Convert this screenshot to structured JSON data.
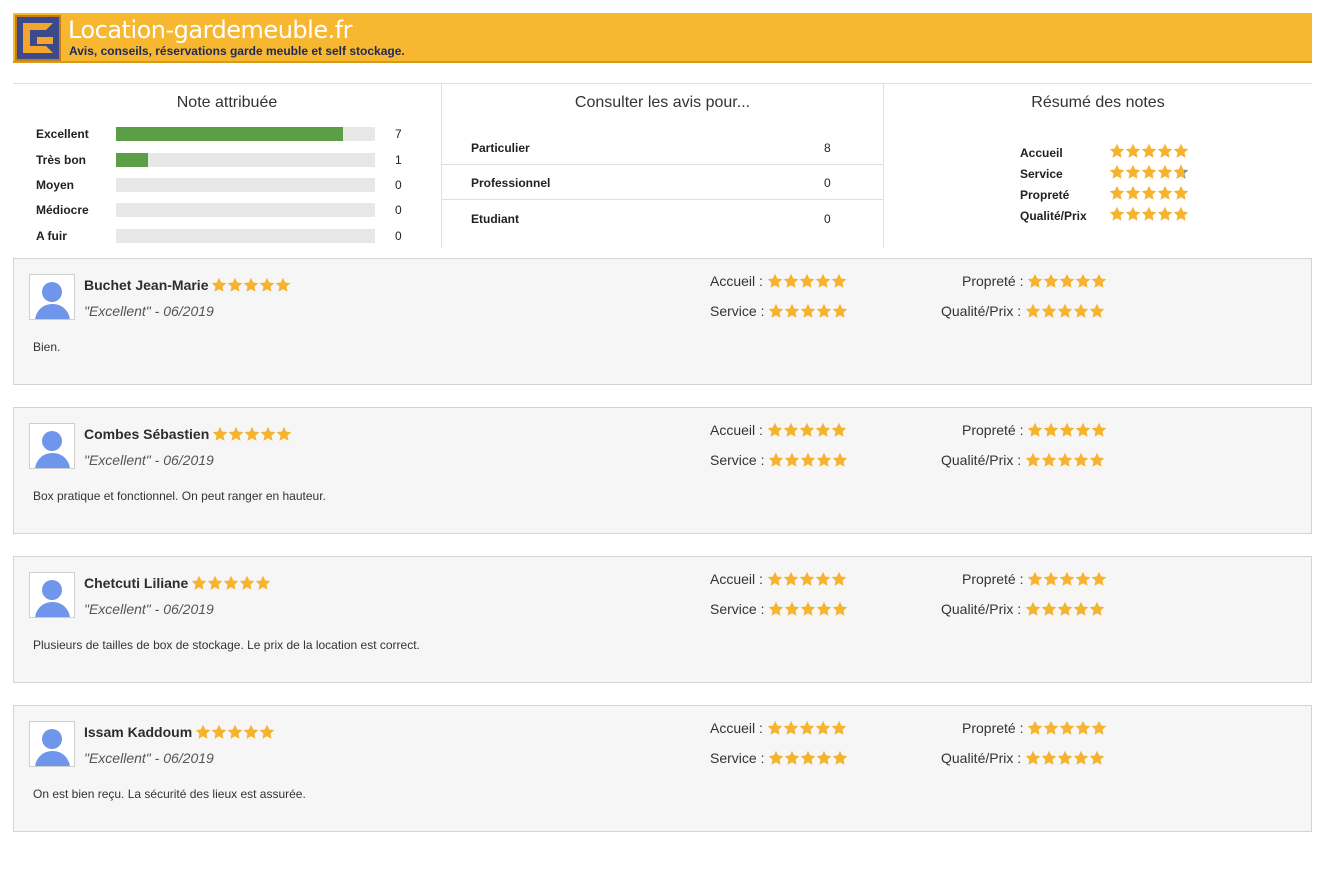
{
  "header": {
    "title": "Location-gardemeuble.fr",
    "subtitle": "Avis, conseils, réservations garde meuble et self stockage."
  },
  "colors": {
    "accent": "#f7b731",
    "bar_fill": "#5b9e45",
    "star": "#f5b32e"
  },
  "note_attribuee": {
    "title": "Note attribuée",
    "rows": [
      {
        "label": "Excellent",
        "count": "7",
        "fraction": 0.875
      },
      {
        "label": "Très bon",
        "count": "1",
        "fraction": 0.125
      },
      {
        "label": "Moyen",
        "count": "0",
        "fraction": 0
      },
      {
        "label": "Médiocre",
        "count": "0",
        "fraction": 0
      },
      {
        "label": "A fuir",
        "count": "0",
        "fraction": 0
      }
    ]
  },
  "consulter": {
    "title": "Consulter les avis pour...",
    "rows": [
      {
        "label": "Particulier",
        "count": "8"
      },
      {
        "label": "Professionnel",
        "count": "0"
      },
      {
        "label": "Etudiant",
        "count": "0"
      }
    ]
  },
  "resume": {
    "title": "Résumé des notes",
    "rows": [
      {
        "label": "Accueil",
        "rating": 5
      },
      {
        "label": "Service",
        "rating": 4.7
      },
      {
        "label": "Propreté",
        "rating": 5
      },
      {
        "label": "Qualité/Prix",
        "rating": 5
      }
    ]
  },
  "criteria_labels": {
    "accueil": "Accueil :",
    "service": "Service :",
    "proprete": "Propreté :",
    "qualite": "Qualité/Prix :"
  },
  "reviews": [
    {
      "name": "Buchet Jean-Marie",
      "verdict": "\"Excellent\"",
      "date": "- 06/2019",
      "text": "Bien.",
      "rating": 5,
      "accueil": 5,
      "service": 5,
      "proprete": 5,
      "qualite": 5
    },
    {
      "name": "Combes Sébastien",
      "verdict": "\"Excellent\"",
      "date": "- 06/2019",
      "text": "Box pratique et fonctionnel. On peut ranger en hauteur.",
      "rating": 5,
      "accueil": 5,
      "service": 5,
      "proprete": 5,
      "qualite": 5
    },
    {
      "name": "Chetcuti Liliane",
      "verdict": "\"Excellent\"",
      "date": "- 06/2019",
      "text": "Plusieurs de tailles de box de stockage. Le prix de la location est correct.",
      "rating": 5,
      "accueil": 5,
      "service": 5,
      "proprete": 5,
      "qualite": 5
    },
    {
      "name": "Issam Kaddoum",
      "verdict": "\"Excellent\"",
      "date": "- 06/2019",
      "text": "On est bien reçu. La sécurité des lieux est assurée.",
      "rating": 5,
      "accueil": 5,
      "service": 5,
      "proprete": 5,
      "qualite": 5
    }
  ]
}
